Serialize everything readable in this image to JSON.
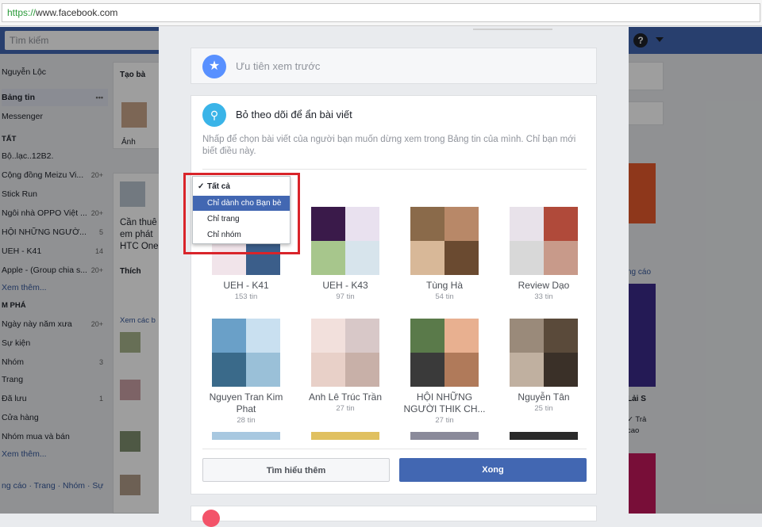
{
  "browser": {
    "scheme": "https://",
    "host": "www.facebook.com"
  },
  "topbar": {
    "search_placeholder": "Tìm kiếm",
    "help": "?"
  },
  "left_nav": [
    {
      "label": "Nguyễn Lộc",
      "count": "",
      "type": "item"
    },
    {
      "label": "Bảng tin",
      "count": "•••",
      "type": "item"
    },
    {
      "label": "Messenger",
      "count": "",
      "type": "item"
    },
    {
      "label": "TẤT",
      "count": "",
      "type": "section"
    },
    {
      "label": "Bộ..lạc..12B2.",
      "count": "",
      "type": "item"
    },
    {
      "label": "Cộng đồng Meizu Vi...",
      "count": "20+",
      "type": "item"
    },
    {
      "label": "Stick Run",
      "count": "",
      "type": "item"
    },
    {
      "label": "Ngôi nhà OPPO Việt ...",
      "count": "20+",
      "type": "item"
    },
    {
      "label": "HỘI NHỮNG NGƯỜ...",
      "count": "5",
      "type": "item"
    },
    {
      "label": "UEH - K41",
      "count": "14",
      "type": "item"
    },
    {
      "label": "Apple - (Group chia s...",
      "count": "20+",
      "type": "item"
    },
    {
      "label": "Xem thêm...",
      "count": "",
      "type": "link"
    },
    {
      "label": "M PHÁ",
      "count": "",
      "type": "section"
    },
    {
      "label": "Ngày này năm xưa",
      "count": "20+",
      "type": "item"
    },
    {
      "label": "Sự kiện",
      "count": "",
      "type": "item"
    },
    {
      "label": "Nhóm",
      "count": "3",
      "type": "item"
    },
    {
      "label": "Trang",
      "count": "",
      "type": "item"
    },
    {
      "label": "Đã lưu",
      "count": "1",
      "type": "item"
    },
    {
      "label": "Cửa hàng",
      "count": "",
      "type": "item"
    },
    {
      "label": "Nhóm mua và bán",
      "count": "",
      "type": "item"
    },
    {
      "label": "Xem thêm...",
      "count": "",
      "type": "link"
    },
    {
      "label": "ng cáo · Trang · Nhóm · Sự",
      "count": "",
      "type": "link"
    }
  ],
  "feed": {
    "create_post": "Tạo bà",
    "photo": "Ảnh",
    "post_text": "Cần thuê em phát HTC One",
    "like": "Thích",
    "see_more": "Xem các b",
    "reply": "Trả"
  },
  "right_col": {
    "ads": "ng cáo",
    "ad_title": "Lải S",
    "reply": "✓ Trả",
    "cao": "cao"
  },
  "modal": {
    "see_first": {
      "title": "Ưu tiên xem trước",
      "icon": "star-icon"
    },
    "unfollow": {
      "title": "Bỏ theo dõi để ẩn bài viết",
      "icon": "search-icon",
      "description": "Nhấp để chọn bài viết của người bạn muốn dừng xem trong Bảng tin của mình. Chỉ bạn mới biết điều này.",
      "filter": {
        "options": [
          "Tất cả",
          "Chỉ dành cho Bạn bè",
          "Chỉ trang",
          "Chỉ nhóm"
        ],
        "checked": "Tất cả",
        "highlighted": "Chỉ dành cho Bạn bè"
      },
      "tiles": [
        {
          "name": "UEH - K41",
          "count": "153 tin"
        },
        {
          "name": "UEH - K43",
          "count": "97 tin"
        },
        {
          "name": "Tùng Hà",
          "count": "54 tin"
        },
        {
          "name": "Review Dạo",
          "count": "33 tin"
        },
        {
          "name": "Nguyen Tran Kim Phat",
          "count": "28 tin"
        },
        {
          "name": "Anh Lê Trúc Trần",
          "count": "27 tin"
        },
        {
          "name": "HỘI NHỮNG NGƯỜI THIK CH...",
          "count": "27 tin"
        },
        {
          "name": "Nguyễn Tân",
          "count": "25 tin"
        }
      ],
      "learn_more": "Tìm hiểu thêm",
      "done": "Xong"
    }
  },
  "colors": {
    "fb_blue": "#4267b2",
    "highlight_red": "#d9242a",
    "star_blue": "#5890ff",
    "search_teal": "#3ab4e8"
  }
}
